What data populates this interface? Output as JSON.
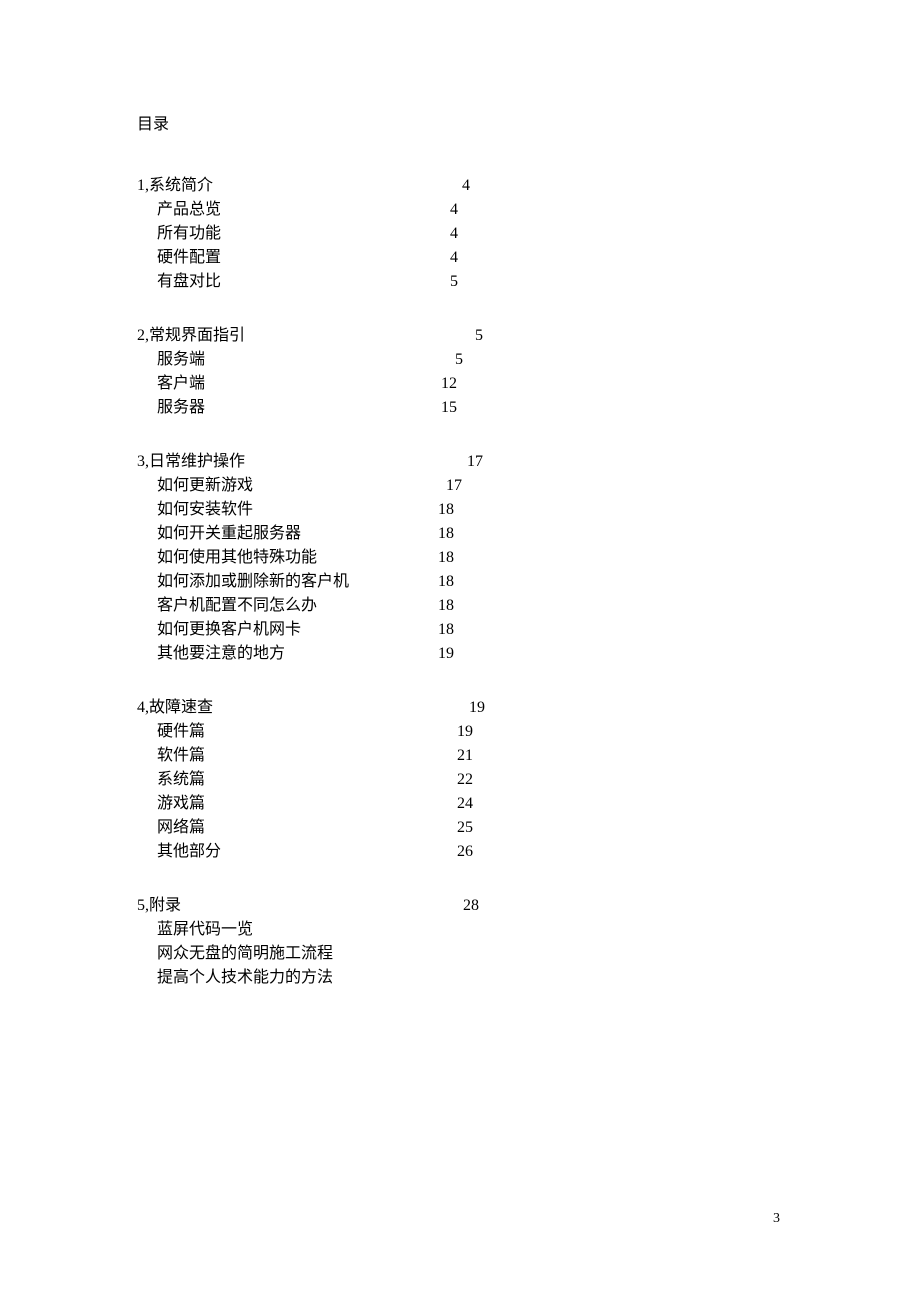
{
  "title": "目录",
  "sections": [
    {
      "heading": "1,系统简介",
      "page": "4",
      "items": [
        {
          "label": "产品总览",
          "page": "4"
        },
        {
          "label": "所有功能",
          "page": "4"
        },
        {
          "label": "硬件配置",
          "page": "4"
        },
        {
          "label": "有盘对比",
          "page": "5"
        }
      ]
    },
    {
      "heading": "2,常规界面指引",
      "page": "5",
      "items": [
        {
          "label": "服务端",
          "page": "5"
        },
        {
          "label": "客户端",
          "page": "12"
        },
        {
          "label": "服务器",
          "page": "15"
        }
      ]
    },
    {
      "heading": "3,日常维护操作",
      "page": "17",
      "items": [
        {
          "label": "如何更新游戏",
          "page": "17"
        },
        {
          "label": "如何安装软件",
          "page": "18"
        },
        {
          "label": "如何开关重起服务器",
          "page": "18"
        },
        {
          "label": "如何使用其他特殊功能",
          "page": "18"
        },
        {
          "label": "如何添加或删除新的客户机",
          "page": "18"
        },
        {
          "label": "客户机配置不同怎么办",
          "page": "18"
        },
        {
          "label": "如何更换客户机网卡",
          "page": "18"
        },
        {
          "label": "其他要注意的地方",
          "page": "19"
        }
      ]
    },
    {
      "heading": "4,故障速查",
      "page": "19",
      "items": [
        {
          "label": "硬件篇",
          "page": "19"
        },
        {
          "label": "软件篇",
          "page": "21"
        },
        {
          "label": "系统篇",
          "page": "22"
        },
        {
          "label": "游戏篇",
          "page": "24"
        },
        {
          "label": "网络篇",
          "page": "25"
        },
        {
          "label": "其他部分",
          "page": "26"
        }
      ]
    },
    {
      "heading": "5,附录",
      "page": "28",
      "items": [
        {
          "label": "蓝屏代码一览",
          "page": ""
        },
        {
          "label": "网众无盘的简明施工流程",
          "page": ""
        },
        {
          "label": "提高个人技术能力的方法",
          "page": ""
        }
      ]
    }
  ],
  "pageNumber": "3"
}
